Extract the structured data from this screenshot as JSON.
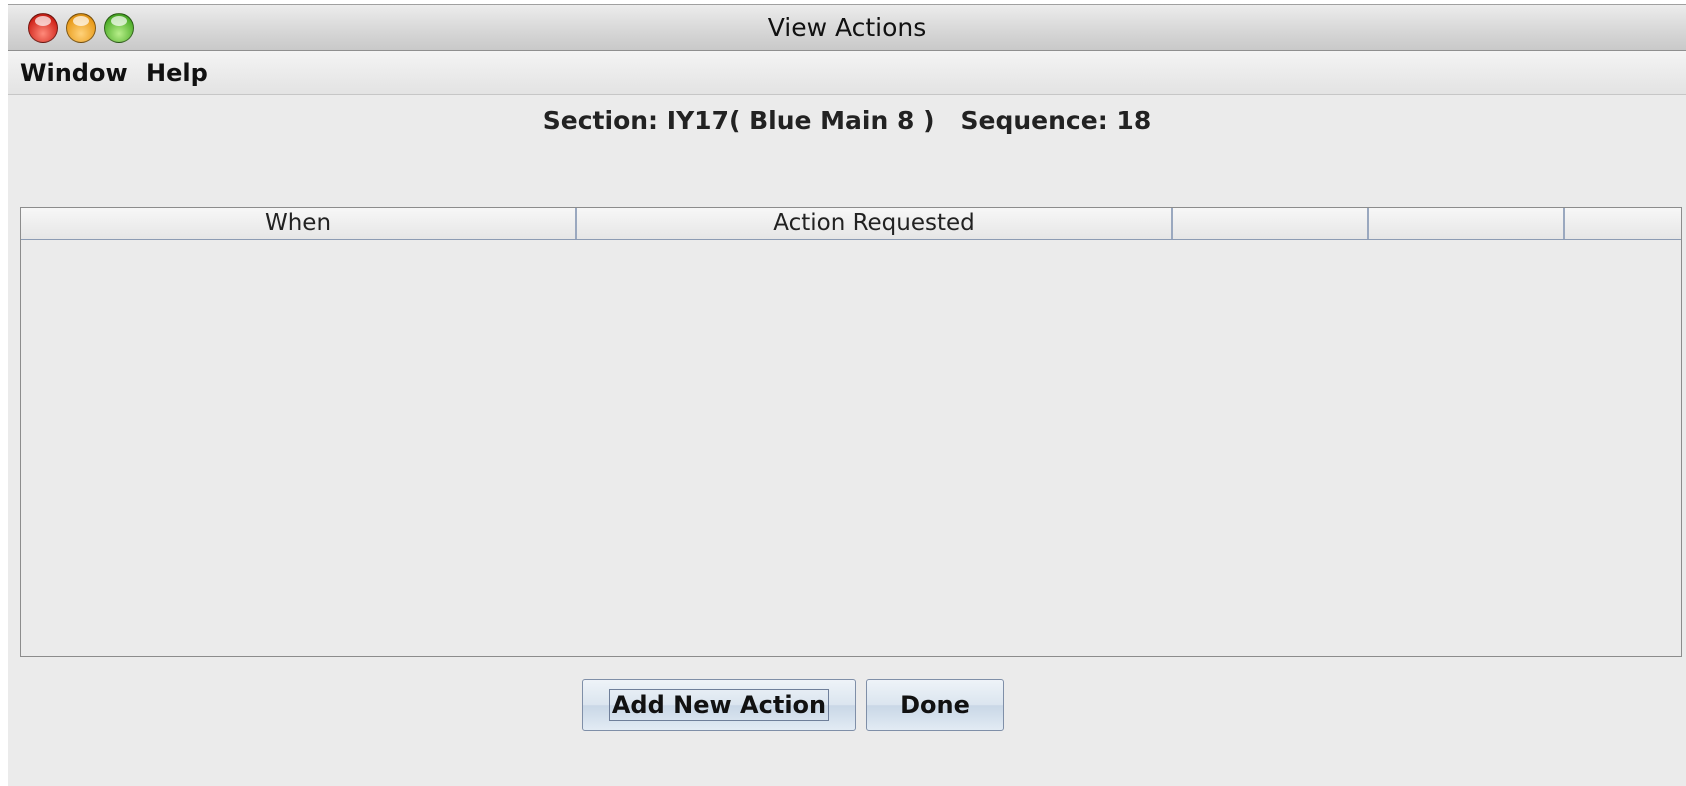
{
  "window": {
    "title": "View Actions"
  },
  "menu": {
    "items": [
      "Window",
      "Help"
    ]
  },
  "header": {
    "section_label": "Section:",
    "section_value": "IY17( Blue Main 8 )",
    "sequence_label": "Sequence:",
    "sequence_value": "18"
  },
  "table": {
    "columns": [
      "When",
      "Action Requested",
      "",
      "",
      ""
    ],
    "rows": []
  },
  "buttons": {
    "add_label": "Add New Action",
    "done_label": "Done"
  },
  "icons": {
    "close": "close-icon",
    "minimize": "minimize-icon",
    "zoom": "zoom-icon"
  },
  "colors": {
    "close": "#d0241a",
    "minimize": "#e89a18",
    "zoom": "#4fae2a"
  }
}
